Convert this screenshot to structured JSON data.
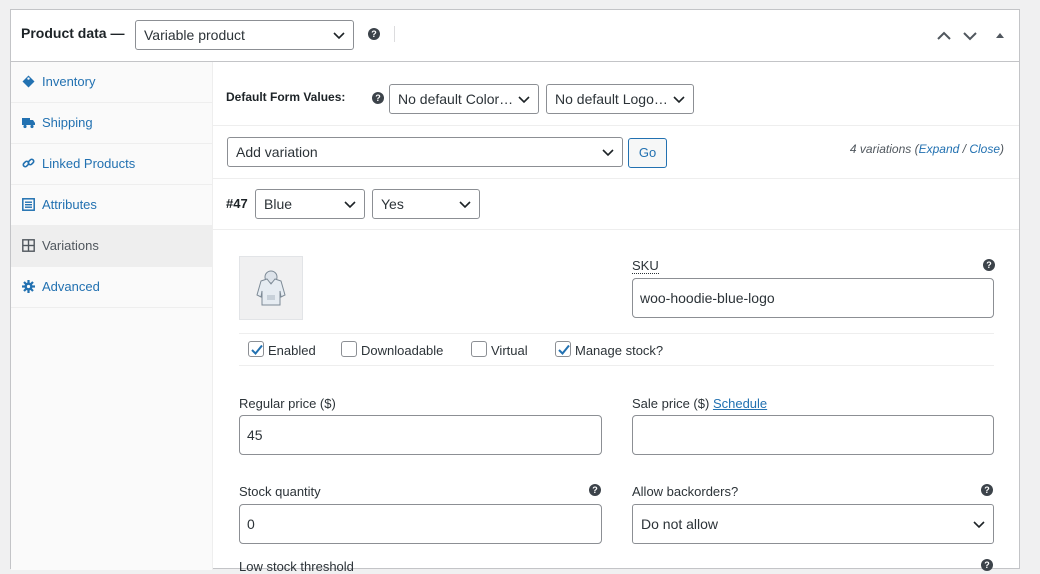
{
  "header": {
    "title": "Product data —",
    "product_type": "Variable product"
  },
  "sidebar": {
    "items": [
      {
        "label": "Inventory",
        "icon": "tag-icon"
      },
      {
        "label": "Shipping",
        "icon": "truck-icon"
      },
      {
        "label": "Linked Products",
        "icon": "link-icon"
      },
      {
        "label": "Attributes",
        "icon": "list-icon"
      },
      {
        "label": "Variations",
        "icon": "grid-icon",
        "active": true
      },
      {
        "label": "Advanced",
        "icon": "gear-icon"
      }
    ]
  },
  "defaults": {
    "label": "Default Form Values:",
    "color_select": "No default Color…",
    "logo_select": "No default Logo…"
  },
  "add_variation": {
    "select": "Add variation",
    "go": "Go",
    "count": "4 variations (",
    "expand": "Expand",
    "sep": " / ",
    "close": "Close",
    "count_end": ")"
  },
  "variation": {
    "id": "#47",
    "color": "Blue",
    "logo": "Yes",
    "sku_label": "SKU",
    "sku_value": "woo-hoodie-blue-logo",
    "checkboxes": [
      {
        "label": "Enabled",
        "checked": true
      },
      {
        "label": "Downloadable",
        "checked": false
      },
      {
        "label": "Virtual",
        "checked": false
      },
      {
        "label": "Manage stock?",
        "checked": true
      }
    ],
    "regular_price_label": "Regular price ($)",
    "regular_price": "45",
    "sale_price_label": "Sale price ($)",
    "schedule": "Schedule",
    "sale_price": "",
    "stock_qty_label": "Stock quantity",
    "stock_qty": "0",
    "backorders_label": "Allow backorders?",
    "backorders_value": "Do not allow",
    "low_stock_label": "Low stock threshold"
  },
  "colors": {
    "link": "#2271b1",
    "border": "#8c8f94",
    "text": "#1d2327"
  }
}
